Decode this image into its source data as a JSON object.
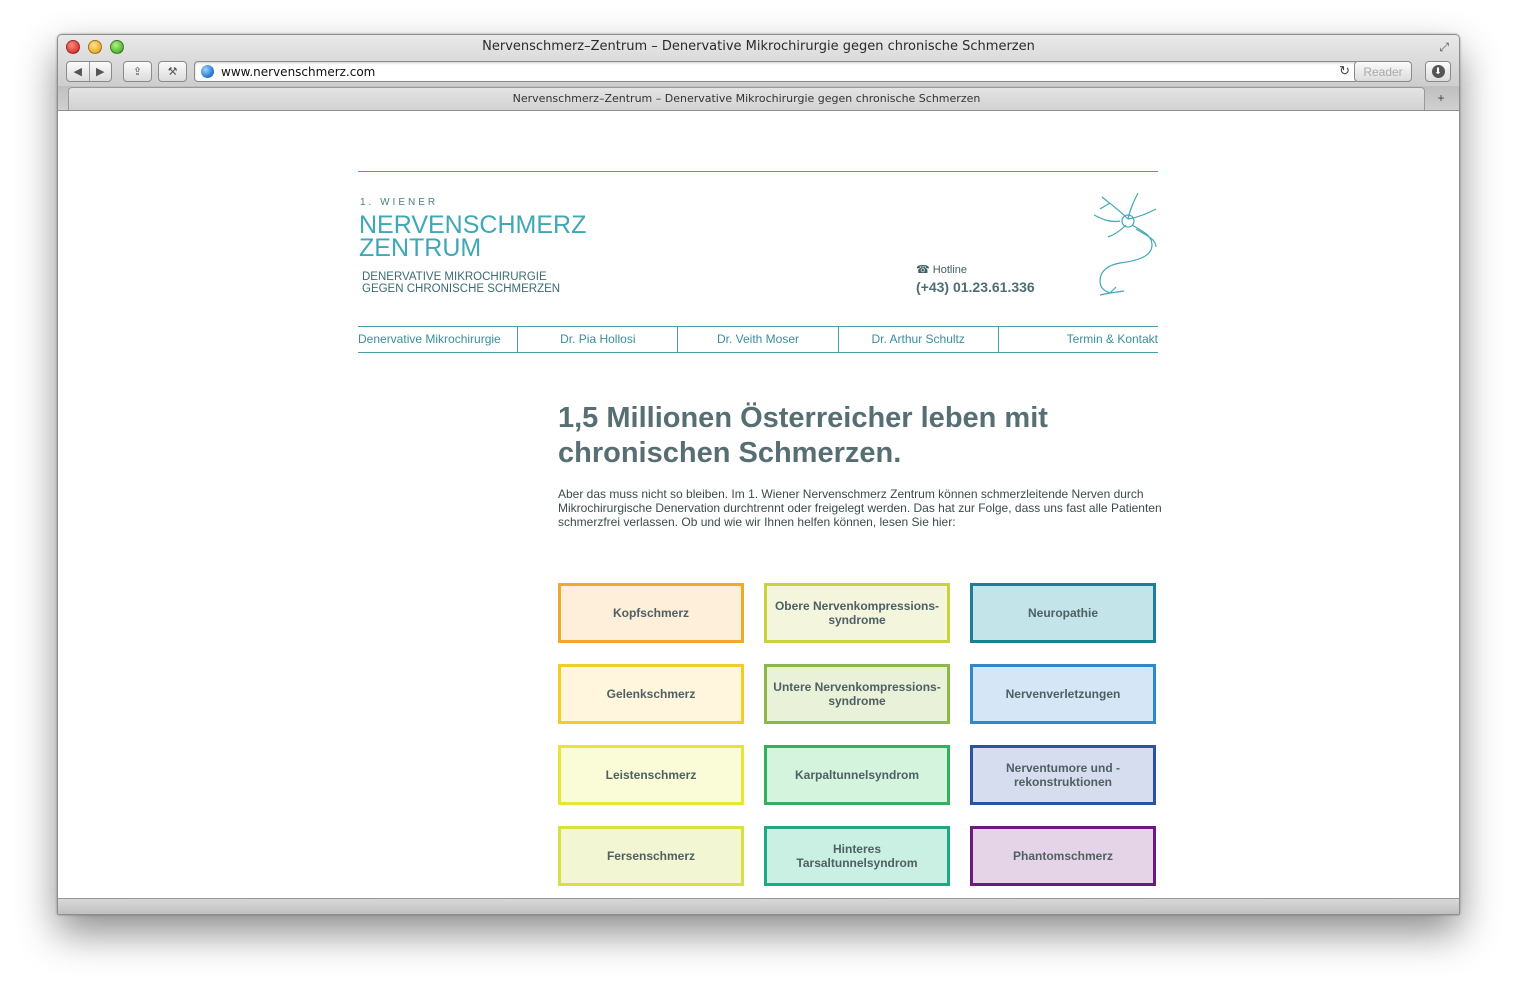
{
  "browser": {
    "window_title": "Nervenschmerz–Zentrum – Denervative Mikrochirurgie gegen chronische Schmerzen",
    "url": "www.nervenschmerz.com",
    "reader_label": "Reader",
    "tab_title": "Nervenschmerz–Zentrum – Denervative Mikrochirurgie gegen chronische Schmerzen",
    "back_glyph": "◀",
    "forward_glyph": "▶",
    "share_glyph": "⇪",
    "tools_glyph": "⚒",
    "reload_glyph": "↻",
    "download_glyph": "⬇",
    "newtab_glyph": "+",
    "resize_glyph": "⤢"
  },
  "header": {
    "logo_sup": "1. WIENER",
    "logo_line1": "NERVENSCHMERZ",
    "logo_line2": "ZENTRUM",
    "tagline_line1": "DENERVATIVE MIKROCHIRURGIE",
    "tagline_line2": "GEGEN CHRONISCHE SCHMERZEN",
    "hotline_label": "☎ Hotline",
    "hotline_number": "(+43) 01.23.61.336"
  },
  "nav": [
    "Denervative Mikrochirurgie",
    "Dr. Pia Hollosi",
    "Dr. Veith Moser",
    "Dr. Arthur Schultz",
    "Termin & Kontakt"
  ],
  "main": {
    "headline": "1,5 Millionen Österreicher leben mit chronischen Schmerzen.",
    "intro": "Aber das muss nicht so bleiben. Im 1. Wiener Nervenschmerz Zentrum können schmerzleitende Nerven durch Mikrochirurgische Denervation durchtrennt oder freigelegt werden. Das hat zur Folge, dass uns fast alle Patienten schmerzfrei verlassen. Ob und wie wir Ihnen helfen können, lesen Sie hier:"
  },
  "tiles": [
    {
      "label": "Kopfschmerz",
      "bg": "#fdefd9",
      "border": "#f0a92c"
    },
    {
      "label": "Obere Nervenkompressions-syndrome",
      "bg": "#f3f6dd",
      "border": "#c8d23a"
    },
    {
      "label": "Neuropathie",
      "bg": "#c3e4e8",
      "border": "#1c7f95"
    },
    {
      "label": "Gelenkschmerz",
      "bg": "#fff6dd",
      "border": "#f2cd26"
    },
    {
      "label": "Untere Nervenkompressions-syndrome",
      "bg": "#e9f1d8",
      "border": "#8cb84a"
    },
    {
      "label": "Nervenverletzungen",
      "bg": "#d5e6f6",
      "border": "#2f88cc"
    },
    {
      "label": "Leistenschmerz",
      "bg": "#fafcd7",
      "border": "#e8e630"
    },
    {
      "label": "Karpaltunnelsyndrom",
      "bg": "#d4f4de",
      "border": "#31b062"
    },
    {
      "label": "Nerventumore und -rekonstruktionen",
      "bg": "#d6ddef",
      "border": "#2a53a7"
    },
    {
      "label": "Fersenschmerz",
      "bg": "#f3f6d3",
      "border": "#d8df45"
    },
    {
      "label": "Hinteres Tarsaltunnelsyndrom",
      "bg": "#c9f0e3",
      "border": "#1ea884"
    },
    {
      "label": "Phantomschmerz",
      "bg": "#e5d4e8",
      "border": "#6b1a80"
    }
  ],
  "colors": {
    "accent": "#3fa8b6",
    "rule": "#4a9fa8",
    "headline": "#576f73"
  }
}
